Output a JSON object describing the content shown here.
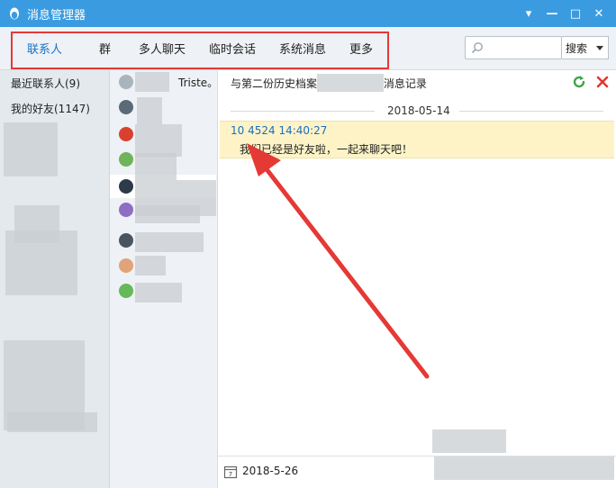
{
  "window": {
    "title": "消息管理器",
    "controls": [
      "▾",
      "—",
      "□",
      "✕"
    ]
  },
  "tabs": [
    {
      "label": "联系人",
      "active": true
    },
    {
      "label": "群",
      "active": false
    },
    {
      "label": "多人聊天",
      "active": false
    },
    {
      "label": "临时会话",
      "active": false
    },
    {
      "label": "系统消息",
      "active": false
    },
    {
      "label": "更多",
      "active": false
    }
  ],
  "search": {
    "placeholder": "",
    "button_label": "搜索"
  },
  "groups": [
    {
      "label": "最近联系人(9)"
    },
    {
      "label": "我的好友(1147)"
    }
  ],
  "contacts": [
    {
      "label": "Triste。",
      "avatar_color": "#a9b4bd"
    },
    {
      "label": "",
      "avatar_color": "#5a6a78"
    },
    {
      "label": "",
      "avatar_color": "#d9412f"
    },
    {
      "label": "",
      "avatar_color": "#6fb35a"
    },
    {
      "label": "",
      "avatar_color": "#2d3a4a"
    },
    {
      "label": "",
      "avatar_color": "#8c6fc2"
    },
    {
      "label": "",
      "avatar_color": "#4b5560"
    },
    {
      "label": "",
      "avatar_color": "#e2a27a"
    },
    {
      "label": "",
      "avatar_color": "#66b85a"
    }
  ],
  "conversation": {
    "header_prefix": "与第二份历史档案",
    "header_suffix": "消息记录",
    "date_separator": "2018-05-14",
    "message": {
      "meta": "10  4524 14:40:27",
      "text": "我们已经是好友啦，一起来聊天吧！"
    }
  },
  "footer": {
    "date": "2018-5-26"
  },
  "colors": {
    "titlebar": "#3b9be0",
    "active_tab": "#1a73c9",
    "annotation": "#e53935",
    "message_bg": "#fdf3c7"
  }
}
